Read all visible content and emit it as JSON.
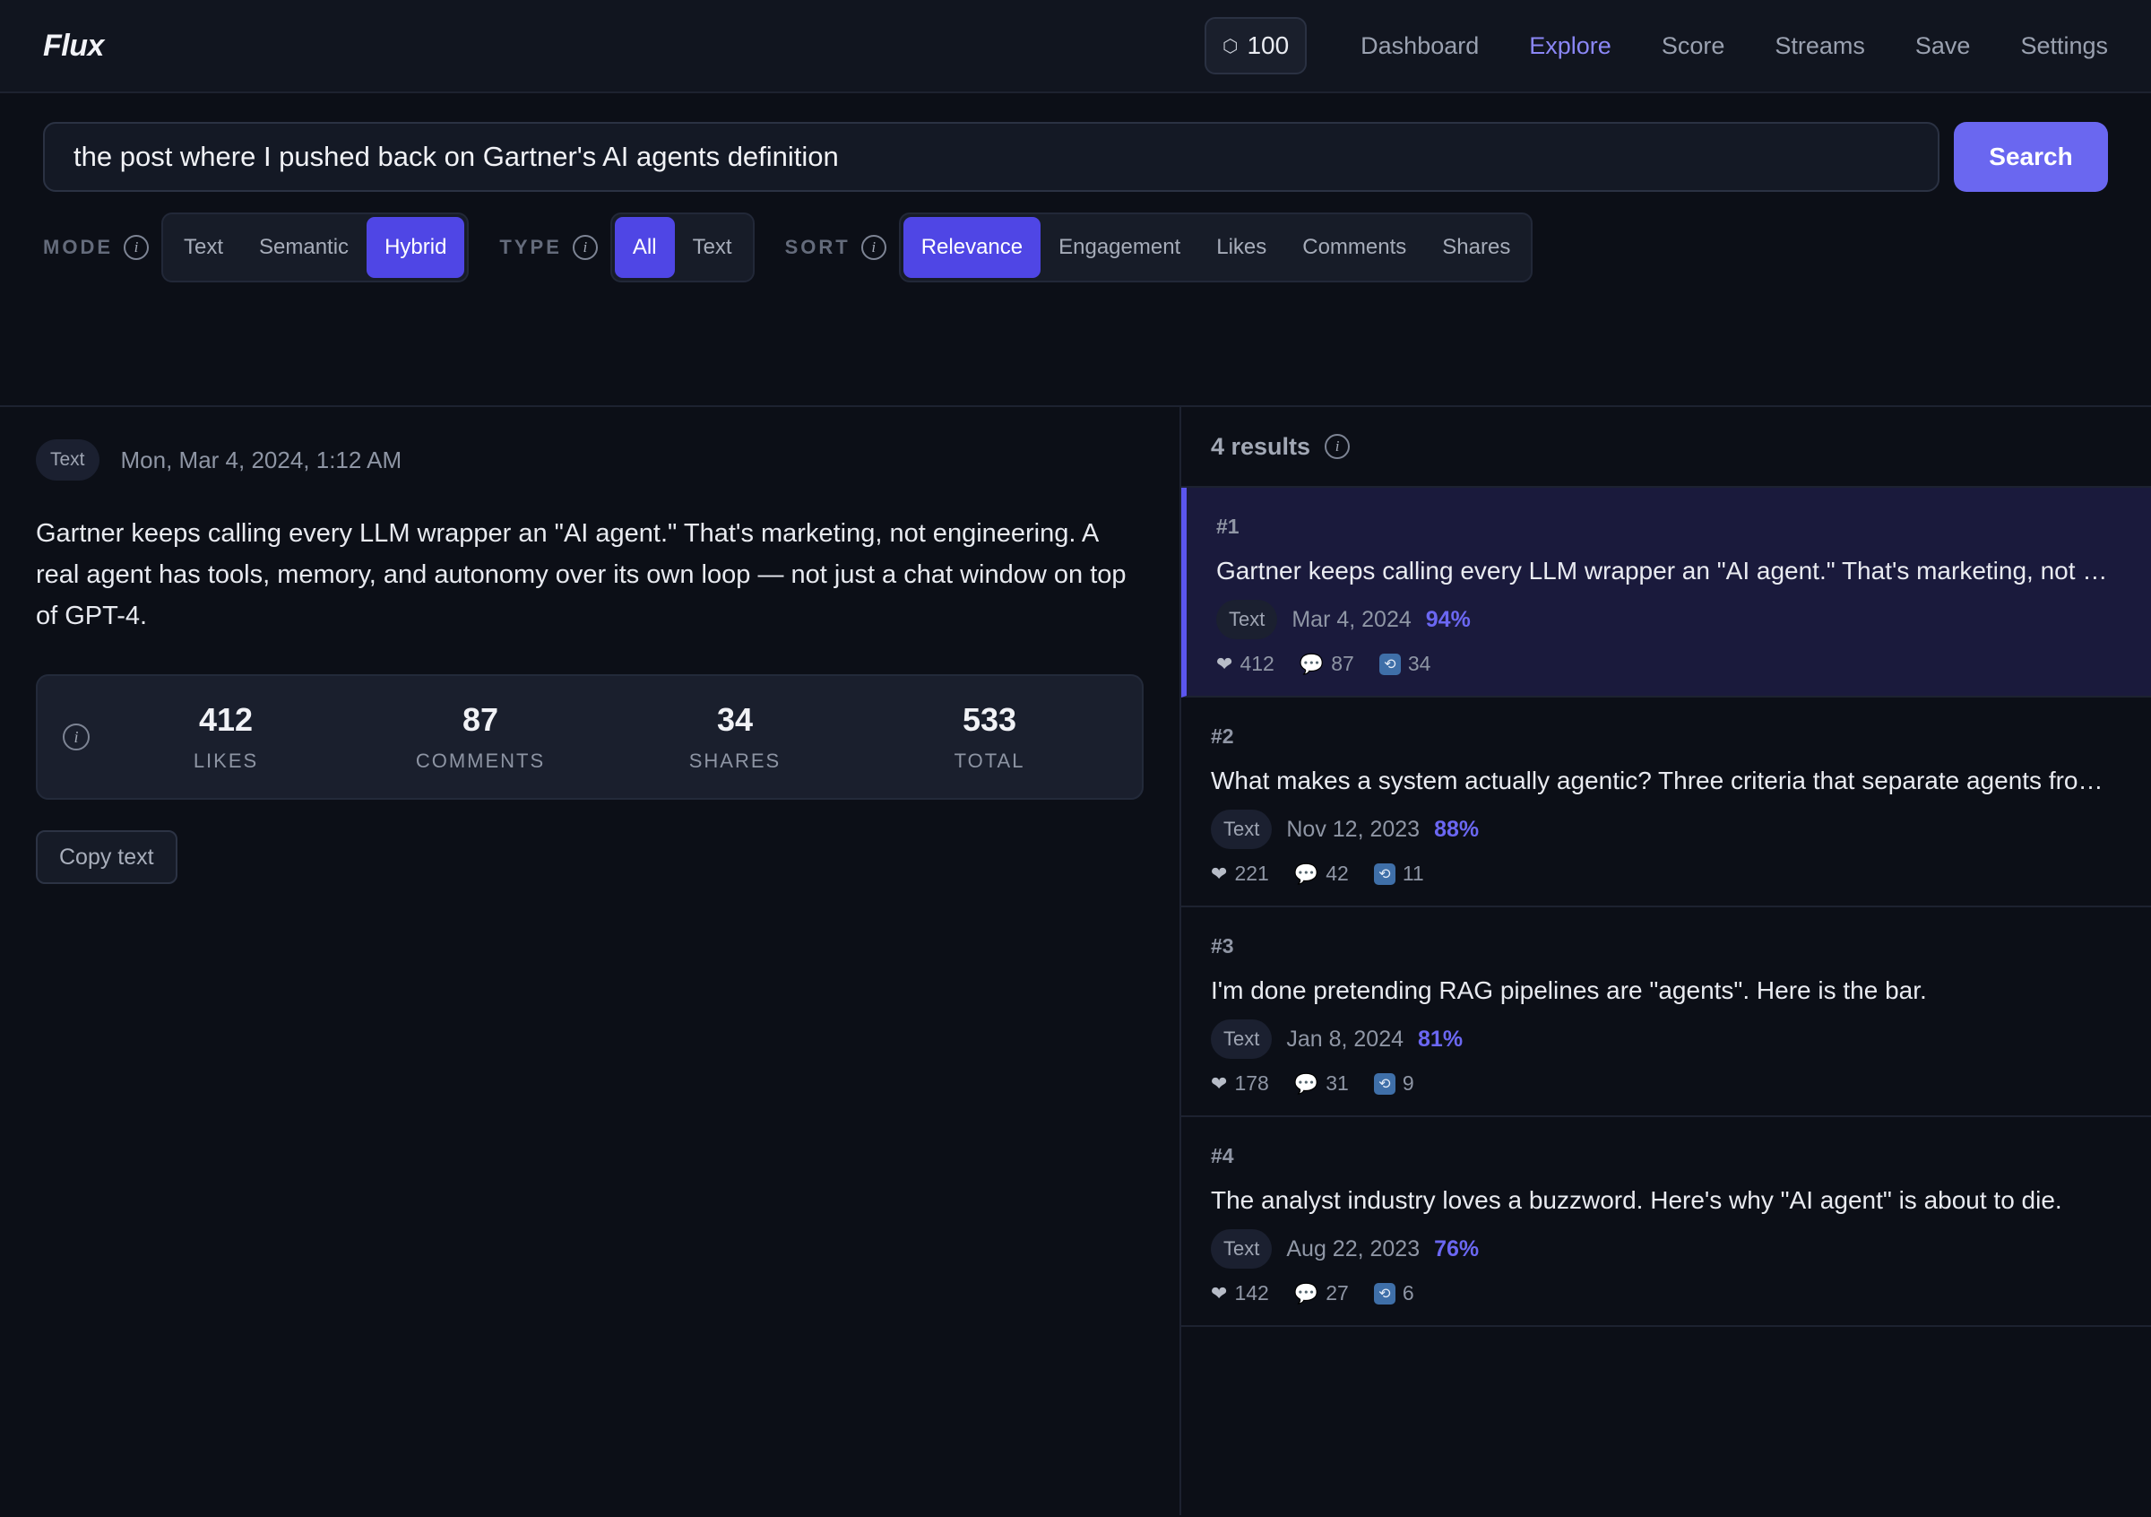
{
  "app": {
    "name": "Flux"
  },
  "nav": {
    "credits": "100",
    "links": [
      "Dashboard",
      "Explore",
      "Score",
      "Streams",
      "Save",
      "Settings"
    ],
    "active": "Explore"
  },
  "search": {
    "query": "the post where I pushed back on Gartner's AI agents definition",
    "button": "Search"
  },
  "filters": {
    "mode": {
      "label": "MODE",
      "options": [
        "Text",
        "Semantic",
        "Hybrid"
      ],
      "active": "Hybrid"
    },
    "type": {
      "label": "TYPE",
      "options": [
        "All",
        "Text"
      ],
      "active": "All"
    },
    "sort": {
      "label": "SORT",
      "options": [
        "Relevance",
        "Engagement",
        "Likes",
        "Comments",
        "Shares"
      ],
      "active": "Relevance"
    }
  },
  "detail": {
    "type": "Text",
    "date": "Mon, Mar 4, 2024, 1:12 AM",
    "body": "Gartner keeps calling every LLM wrapper an \"AI agent.\" That's marketing, not engineering. A real agent has tools, memory, and autonomy over its own loop — not just a chat window on top of GPT-4.",
    "stats": [
      {
        "value": "412",
        "label": "LIKES"
      },
      {
        "value": "87",
        "label": "COMMENTS"
      },
      {
        "value": "34",
        "label": "SHARES"
      },
      {
        "value": "533",
        "label": "TOTAL"
      }
    ],
    "copy_label": "Copy text"
  },
  "results": {
    "count_label": "4 results",
    "items": [
      {
        "rank": "#1",
        "title": "Gartner keeps calling every LLM wrapper an \"AI agent.\" That's marketing, not engineering. A real agent has tools, memory, and autonomy",
        "type": "Text",
        "date": "Mar 4, 2024",
        "score": "94%",
        "likes": "412",
        "comments": "87",
        "shares": "34",
        "selected": true
      },
      {
        "rank": "#2",
        "title": "What makes a system actually agentic? Three criteria that separate agents from chatbots with extra steps",
        "type": "Text",
        "date": "Nov 12, 2023",
        "score": "88%",
        "likes": "221",
        "comments": "42",
        "shares": "11",
        "selected": false
      },
      {
        "rank": "#3",
        "title": "I'm done pretending RAG pipelines are \"agents\". Here is the bar.",
        "type": "Text",
        "date": "Jan 8, 2024",
        "score": "81%",
        "likes": "178",
        "comments": "31",
        "shares": "9",
        "selected": false
      },
      {
        "rank": "#4",
        "title": "The analyst industry loves a buzzword. Here's why \"AI agent\" is about to die.",
        "type": "Text",
        "date": "Aug 22, 2023",
        "score": "76%",
        "likes": "142",
        "comments": "27",
        "shares": "6",
        "selected": false
      }
    ]
  },
  "icons": {
    "credits": "hexagon-icon",
    "info": "info-icon",
    "likes": "heart-icon",
    "comments": "comment-icon",
    "shares": "repost-icon"
  },
  "colors": {
    "accent": "#4f46e5",
    "accent_text": "#8b87f6",
    "score": "#6b67f2",
    "background": "#0c0f17"
  }
}
